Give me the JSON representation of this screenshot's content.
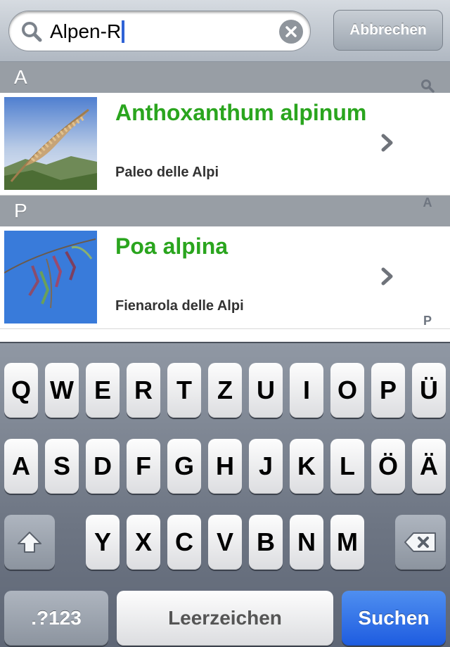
{
  "search": {
    "value": "Alpen-R",
    "cancel_label": "Abbrechen"
  },
  "sections": [
    {
      "header": "A",
      "item": {
        "title": "Anthoxanthum alpinum",
        "subtitle": "Paleo delle Alpi"
      }
    },
    {
      "header": "P",
      "item": {
        "title": "Poa alpina",
        "subtitle": "Fienarola delle Alpi"
      }
    }
  ],
  "index": [
    "A",
    "P"
  ],
  "keyboard": {
    "row1": [
      "Q",
      "W",
      "E",
      "R",
      "T",
      "Z",
      "U",
      "I",
      "O",
      "P",
      "Ü"
    ],
    "row2": [
      "A",
      "S",
      "D",
      "F",
      "G",
      "H",
      "J",
      "K",
      "L",
      "Ö",
      "Ä"
    ],
    "row3": [
      "Y",
      "X",
      "C",
      "V",
      "B",
      "N",
      "M"
    ],
    "numbers_label": ".?123",
    "space_label": "Leerzeichen",
    "search_label": "Suchen"
  },
  "colors": {
    "title_green": "#2aa51e",
    "section_bg": "#989ea5",
    "search_key_blue": "#1e5ce0"
  },
  "icons": [
    "search-icon",
    "clear-icon",
    "chevron-right-icon",
    "shift-icon",
    "backspace-icon"
  ]
}
